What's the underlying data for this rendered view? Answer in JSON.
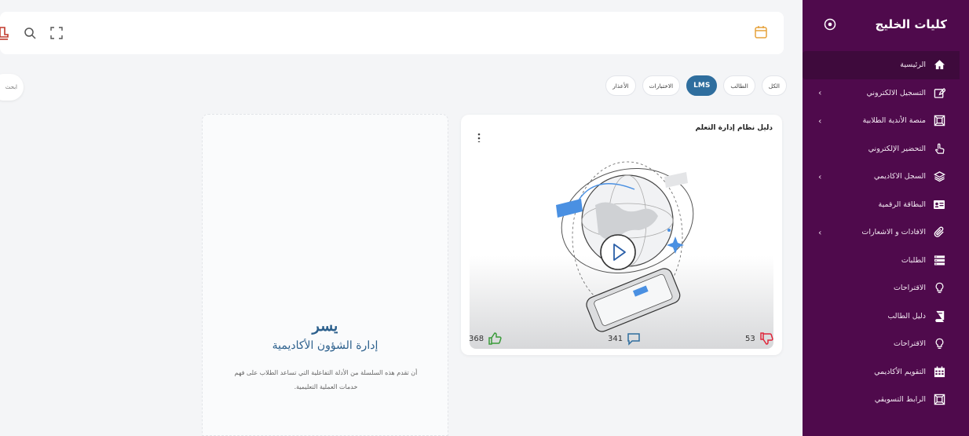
{
  "sidebar": {
    "title": "كليات الخليج",
    "items": [
      {
        "label": "الرئيسية",
        "icon": "home-icon",
        "active": true,
        "has_arrow": false
      },
      {
        "label": "التسجيل الالكتروني",
        "icon": "edit-icon",
        "active": false,
        "has_arrow": true
      },
      {
        "label": "منصة الأندية الطلابية",
        "icon": "frame-icon",
        "active": false,
        "has_arrow": true
      },
      {
        "label": "التحضير الإلكتروني",
        "icon": "hand-pointer-icon",
        "active": false,
        "has_arrow": false
      },
      {
        "label": "السجل الاكاديمي",
        "icon": "layers-icon",
        "active": false,
        "has_arrow": true
      },
      {
        "label": "البطاقة الرقمية",
        "icon": "id-card-icon",
        "active": false,
        "has_arrow": false
      },
      {
        "label": "الافادات و الاشعارات",
        "icon": "paperclip-icon",
        "active": false,
        "has_arrow": true
      },
      {
        "label": "الطلبات",
        "icon": "list-icon",
        "active": false,
        "has_arrow": false
      },
      {
        "label": "الاقتراحات",
        "icon": "lightbulb-icon",
        "active": false,
        "has_arrow": false
      },
      {
        "label": "دليل الطالب",
        "icon": "book-icon",
        "active": false,
        "has_arrow": false
      },
      {
        "label": "الاقتراحات",
        "icon": "lightbulb-icon",
        "active": false,
        "has_arrow": false
      },
      {
        "label": "التقويم الأكاديمي",
        "icon": "calendar-grid-icon",
        "active": false,
        "has_arrow": false
      },
      {
        "label": "الرابط التسويقي",
        "icon": "frame-icon",
        "active": false,
        "has_arrow": false
      }
    ]
  },
  "tabs": [
    {
      "label": "الكل",
      "active": false
    },
    {
      "label": "الطالب",
      "active": false
    },
    {
      "label": "LMS",
      "active": true
    },
    {
      "label": "الاختبارات",
      "active": false
    },
    {
      "label": "الأعذار",
      "active": false
    }
  ],
  "search_stub": "ابحث",
  "card1": {
    "title": "دليل نظام إدارة التعلم",
    "likes": "368",
    "comments": "341",
    "dislikes": "53"
  },
  "card2": {
    "logo": "يسر",
    "heading": "إدارة الشؤون الأكاديمية",
    "description": "أن تقدم هذه السلسلة من الأدلة التفاعلية التي تساعد الطلاب على فهم خدمات العملية التعليمية."
  },
  "colors": {
    "sidebar_bg": "#4f0a4c",
    "accent": "#2f6e9e",
    "like": "#3a9b3a",
    "dislike": "#e0263a"
  }
}
